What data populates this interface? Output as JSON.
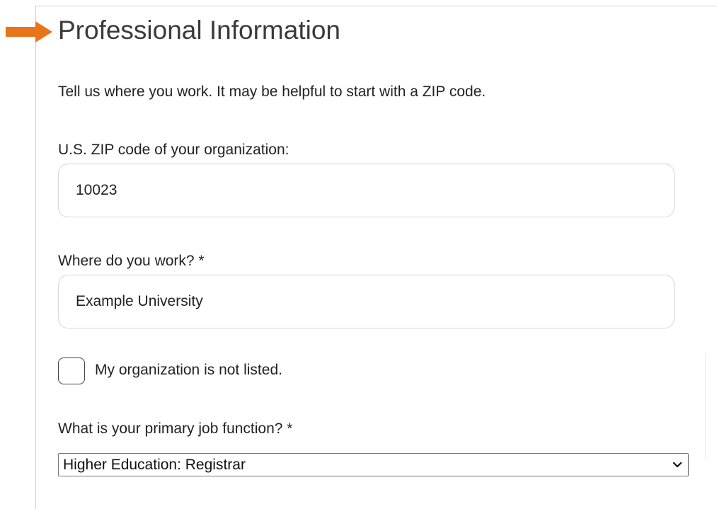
{
  "section": {
    "title": "Professional Information",
    "intro": "Tell us where you work. It may be helpful to start with a ZIP code."
  },
  "fields": {
    "zip": {
      "label": "U.S. ZIP code of your organization:",
      "value": "10023"
    },
    "workplace": {
      "label": "Where do you work? *",
      "value": "Example University"
    },
    "not_listed": {
      "label": "My organization is not listed.",
      "checked": false
    },
    "job_function": {
      "label": "What is your primary job function? *",
      "selected": "Higher Education: Registrar"
    }
  },
  "icons": {
    "pointer": "arrow-right-icon",
    "dropdown": "chevron-down-icon"
  },
  "colors": {
    "arrow": "#E8751A",
    "input_border": "#d6d6d6",
    "text": "#222222"
  }
}
